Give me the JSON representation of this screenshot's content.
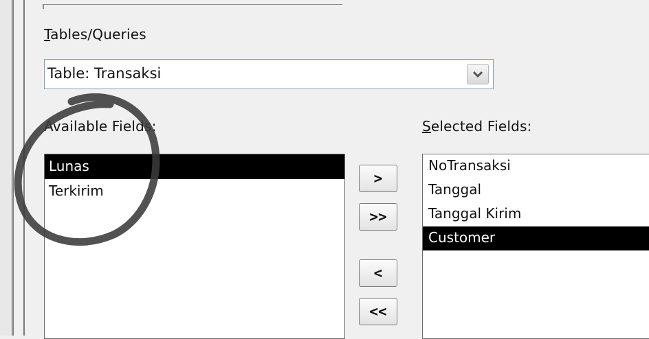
{
  "dialog": {
    "tables_label": "Tables/Queries",
    "tables_label_mnemonic": "T",
    "tables_label_rest": "ables/Queries",
    "table_select_value": "Table: Transaksi",
    "available_label": "Available Fields:",
    "selected_label": "Selected Fields:",
    "selected_label_mnemonic": "S",
    "selected_label_rest": "elected Fields:"
  },
  "available_fields": [
    {
      "label": "Lunas",
      "selected": true
    },
    {
      "label": "Terkirim",
      "selected": false
    }
  ],
  "selected_fields": [
    {
      "label": "NoTransaksi",
      "selected": false
    },
    {
      "label": "Tanggal",
      "selected": false
    },
    {
      "label": "Tanggal Kirim",
      "selected": false
    },
    {
      "label": "Customer",
      "selected": true
    }
  ],
  "buttons": {
    "add_one": ">",
    "add_all": ">>",
    "remove_one": "<",
    "remove_all": "<<"
  },
  "annotation": {
    "color": "#3a3a3a",
    "shape": "hand-drawn circle"
  },
  "icons": {
    "dropdown": "chevron-down-icon"
  }
}
